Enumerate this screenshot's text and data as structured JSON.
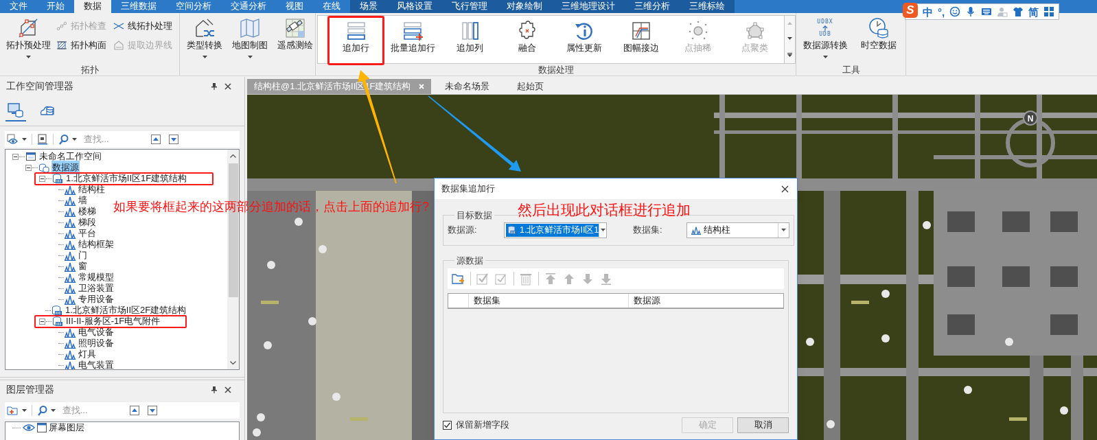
{
  "menu_tabs": [
    {
      "label": "文件",
      "selected": false,
      "contextual": false
    },
    {
      "label": "开始",
      "selected": false,
      "contextual": false
    },
    {
      "label": "数据",
      "selected": true,
      "contextual": false
    },
    {
      "label": "三维数据",
      "selected": false,
      "contextual": false
    },
    {
      "label": "空间分析",
      "selected": false,
      "contextual": false
    },
    {
      "label": "交通分析",
      "selected": false,
      "contextual": false
    },
    {
      "label": "视图",
      "selected": false,
      "contextual": false
    },
    {
      "label": "在线",
      "selected": false,
      "contextual": false
    },
    {
      "label": "场景",
      "selected": false,
      "contextual": true
    },
    {
      "label": "风格设置",
      "selected": false,
      "contextual": true
    },
    {
      "label": "飞行管理",
      "selected": false,
      "contextual": true
    },
    {
      "label": "对象绘制",
      "selected": false,
      "contextual": true
    },
    {
      "label": "三维地理设计",
      "selected": false,
      "contextual": true
    },
    {
      "label": "三维分析",
      "selected": false,
      "contextual": true
    },
    {
      "label": "三维标绘",
      "selected": false,
      "contextual": true
    }
  ],
  "ime_toolbar": {
    "logo": "S",
    "items": [
      {
        "kind": "text",
        "text": "中"
      },
      {
        "kind": "text",
        "text": "°,"
      },
      {
        "kind": "icon"
      },
      {
        "kind": "icon"
      },
      {
        "kind": "icon"
      },
      {
        "kind": "icon"
      },
      {
        "kind": "icon"
      },
      {
        "kind": "text",
        "text": "简"
      },
      {
        "kind": "icon"
      }
    ]
  },
  "ribbon": {
    "groups": [
      {
        "kind": "plain",
        "label": "拓扑",
        "items": [
          {
            "kind": "large",
            "label": "拓扑预处理",
            "dropdown": true,
            "disabled": false
          },
          {
            "kind": "small",
            "label": "拓扑检查",
            "disabled": true
          },
          {
            "kind": "small",
            "label": "拓扑构面",
            "disabled": false
          },
          {
            "kind": "small",
            "label": "线拓扑处理",
            "disabled": false
          },
          {
            "kind": "small",
            "label": "提取边界线",
            "disabled": true
          }
        ]
      },
      {
        "kind": "plain",
        "items": [
          {
            "kind": "large",
            "label": "类型转换",
            "dropdown": true,
            "disabled": false
          },
          {
            "kind": "large",
            "label": "地图制图",
            "dropdown": true,
            "disabled": false
          },
          {
            "kind": "large",
            "label": "遥感测绘",
            "dropdown": false,
            "disabled": false
          }
        ]
      },
      {
        "kind": "gallery",
        "label": "数据处理",
        "items": [
          {
            "kind": "large",
            "label": "追加行",
            "disabled": false,
            "annotated": true
          },
          {
            "kind": "large",
            "label": "批量追加行",
            "disabled": false
          },
          {
            "kind": "large",
            "label": "追加列",
            "disabled": false
          },
          {
            "kind": "large",
            "label": "融合",
            "disabled": false
          },
          {
            "kind": "large",
            "label": "属性更新",
            "disabled": false
          },
          {
            "kind": "large",
            "label": "图幅接边",
            "disabled": false
          },
          {
            "kind": "large",
            "label": "点抽稀",
            "disabled": true
          },
          {
            "kind": "large",
            "label": "点聚类",
            "disabled": true
          }
        ]
      },
      {
        "kind": "plain",
        "label": "工具",
        "items": [
          {
            "kind": "large",
            "label": "数据源转换",
            "dropdown": true,
            "disabled": false,
            "icon_texts": [
              "UDBX",
              "UDB"
            ]
          },
          {
            "kind": "large",
            "label": "时空数据",
            "dropdown": false,
            "disabled": false
          }
        ]
      }
    ]
  },
  "workspace_panel": {
    "title": "工作空间管理器",
    "view_tabs": [
      {
        "selected": true
      },
      {
        "selected": false
      }
    ],
    "search_placeholder": "查找...",
    "tree": [
      {
        "kind": "workspace",
        "label": "未命名工作空间",
        "expanded": true,
        "selected": false,
        "children": [
          {
            "kind": "datasources",
            "label": "数据源",
            "expanded": true,
            "selected": true,
            "children": [
              {
                "kind": "datasource",
                "label": "1.北京鲜活市场II区1F建筑结构",
                "expanded": true,
                "selected": false,
                "annotated": true,
                "children": [
                  {
                    "kind": "dataset",
                    "label": "结构柱",
                    "selected": false
                  },
                  {
                    "kind": "dataset",
                    "label": "墙",
                    "selected": false
                  },
                  {
                    "kind": "dataset",
                    "label": "楼梯",
                    "selected": false
                  },
                  {
                    "kind": "dataset",
                    "label": "梯段",
                    "selected": false
                  },
                  {
                    "kind": "dataset",
                    "label": "平台",
                    "selected": false
                  },
                  {
                    "kind": "dataset",
                    "label": "结构框架",
                    "selected": false
                  },
                  {
                    "kind": "dataset",
                    "label": "门",
                    "selected": false
                  },
                  {
                    "kind": "dataset",
                    "label": "窗",
                    "selected": false
                  },
                  {
                    "kind": "dataset",
                    "label": "常规模型",
                    "selected": false
                  },
                  {
                    "kind": "dataset",
                    "label": "卫浴装置",
                    "selected": false
                  },
                  {
                    "kind": "dataset",
                    "label": "专用设备",
                    "selected": false
                  }
                ]
              },
              {
                "kind": "datasource",
                "label": "1.北京鲜活市场II区2F建筑结构",
                "selected": false
              },
              {
                "kind": "datasource",
                "label": "III-II-服务区-1F电气附件",
                "expanded": true,
                "selected": false,
                "annotated": true,
                "children": [
                  {
                    "kind": "dataset",
                    "label": "电气设备",
                    "selected": false
                  },
                  {
                    "kind": "dataset",
                    "label": "照明设备",
                    "selected": false
                  },
                  {
                    "kind": "dataset",
                    "label": "灯具",
                    "selected": false
                  },
                  {
                    "kind": "dataset",
                    "label": "电气装置",
                    "selected": false
                  }
                ]
              }
            ]
          }
        ]
      }
    ]
  },
  "layer_panel": {
    "title": "图层管理器",
    "search_placeholder": "查找...",
    "tree": [
      {
        "label": "屏幕图层"
      }
    ]
  },
  "doc_tabs": [
    {
      "label": "结构柱@1.北京鲜活市场II区1F建筑结构",
      "selected": true,
      "closable": true
    },
    {
      "label": "未命名场景",
      "selected": false
    },
    {
      "label": "起始页",
      "selected": false
    }
  ],
  "scene": {
    "compass_label": "N"
  },
  "dialog": {
    "title": "数据集追加行",
    "target_group": {
      "title": "目标数据",
      "fields": [
        {
          "kind": "datasource",
          "label": "数据源:",
          "value": "1.北京鲜活市场II区1",
          "highlighted": true
        },
        {
          "kind": "dataset",
          "label": "数据集:",
          "value": "结构柱",
          "highlighted": false
        }
      ]
    },
    "source_group": {
      "title": "源数据",
      "tools": [
        {
          "disabled": false
        },
        {
          "disabled": true
        },
        {
          "disabled": true
        },
        {
          "disabled": true
        },
        {
          "disabled": true
        },
        {
          "disabled": true
        },
        {
          "disabled": true
        },
        {
          "disabled": true
        }
      ],
      "columns": [
        "数据集",
        "数据源"
      ]
    },
    "keep_fields": {
      "label": "保留新增字段",
      "checked": true
    },
    "buttons": [
      {
        "label": "确定",
        "disabled": true
      },
      {
        "label": "取消",
        "disabled": false
      }
    ]
  },
  "annotations": [
    {
      "text": "如果要将框起来的这两部分追加的话，点击上面的追加行?"
    },
    {
      "text": "然后出现此对话框进行追加"
    }
  ]
}
